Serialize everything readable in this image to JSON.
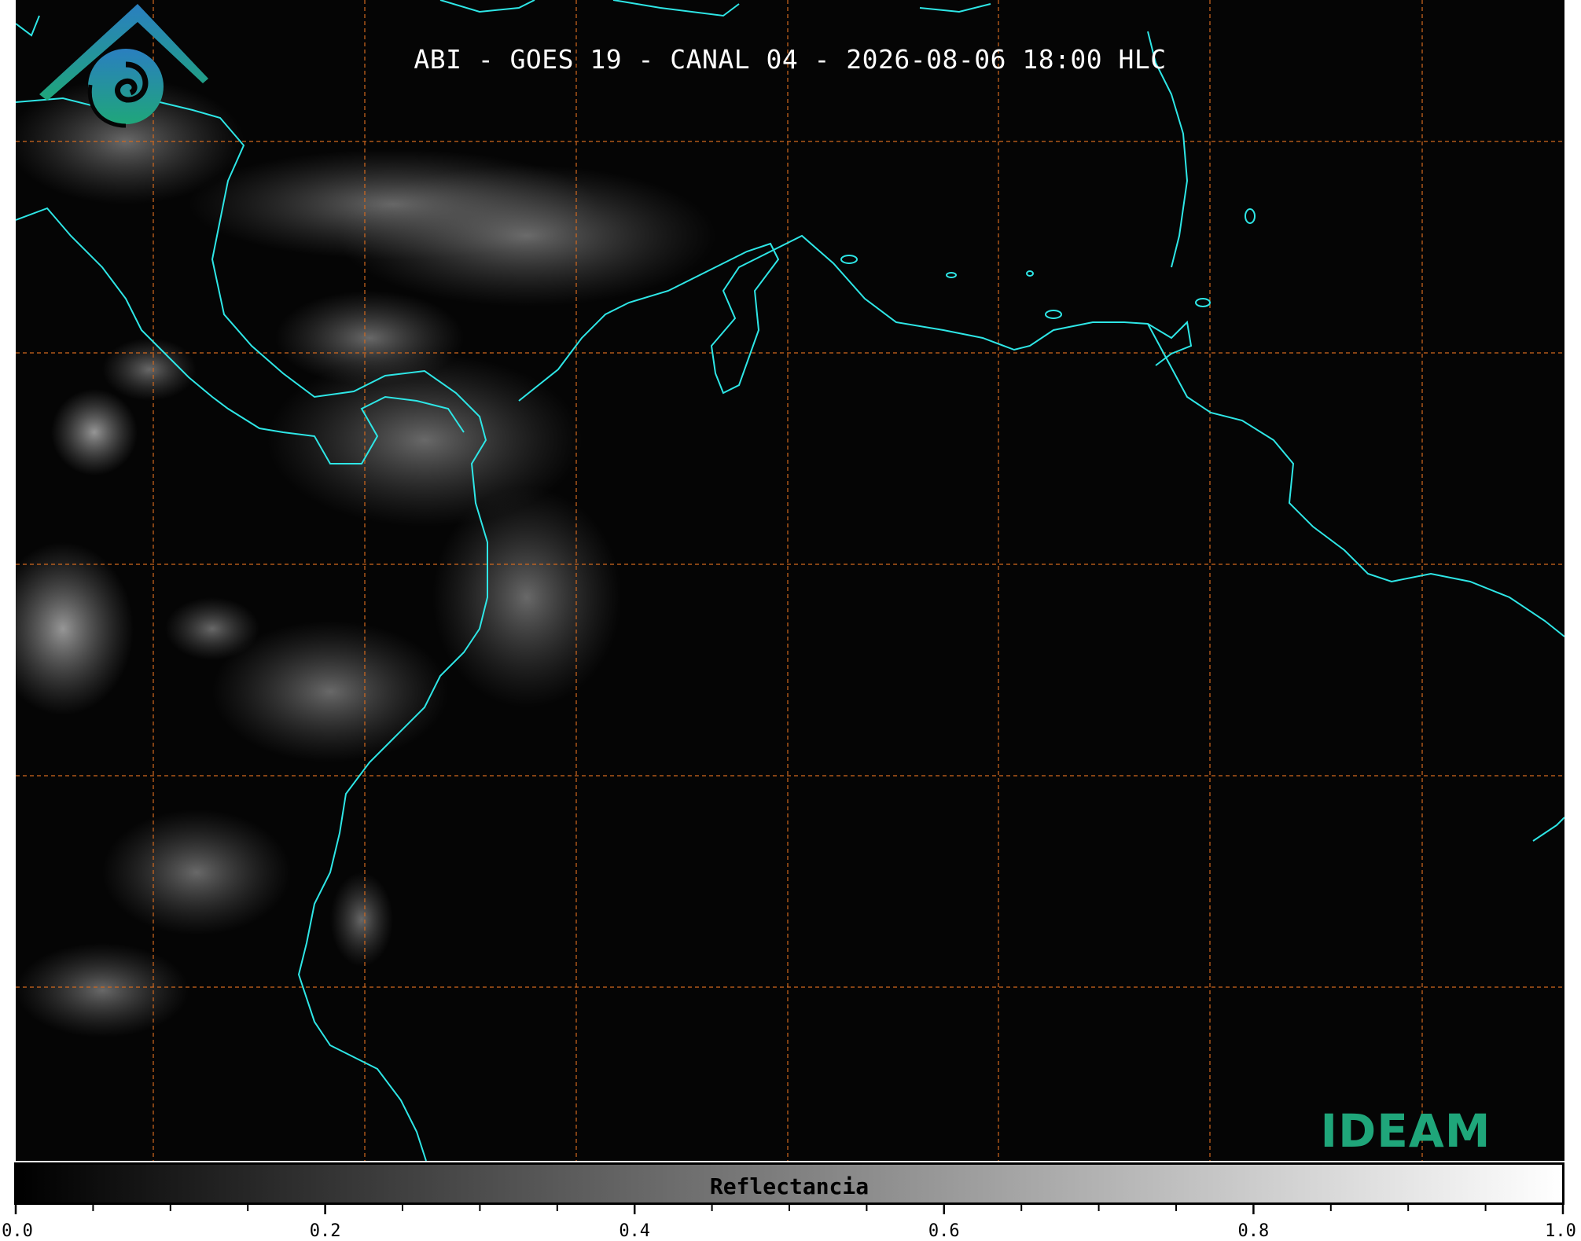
{
  "map": {
    "title": "ABI - GOES 19 - CANAL 04 - 2026-08-06 18:00 HLC",
    "coastline_color": "#2ee6e6",
    "gridline_color": "#d2691e",
    "background_color": "#050505"
  },
  "logo": {
    "text": "IDEAM",
    "colors": [
      "#2a7fc0",
      "#1fa67a"
    ]
  },
  "colorbar": {
    "label": "Reflectancia",
    "min": 0.0,
    "max": 1.0,
    "colors": [
      "#000000",
      "#ffffff"
    ],
    "ticks": [
      "0.0",
      "0.2",
      "0.4",
      "0.6",
      "0.8",
      "1.0"
    ],
    "tick_values": [
      0.0,
      0.2,
      0.4,
      0.6,
      0.8,
      1.0
    ],
    "minor_step": 0.05
  }
}
